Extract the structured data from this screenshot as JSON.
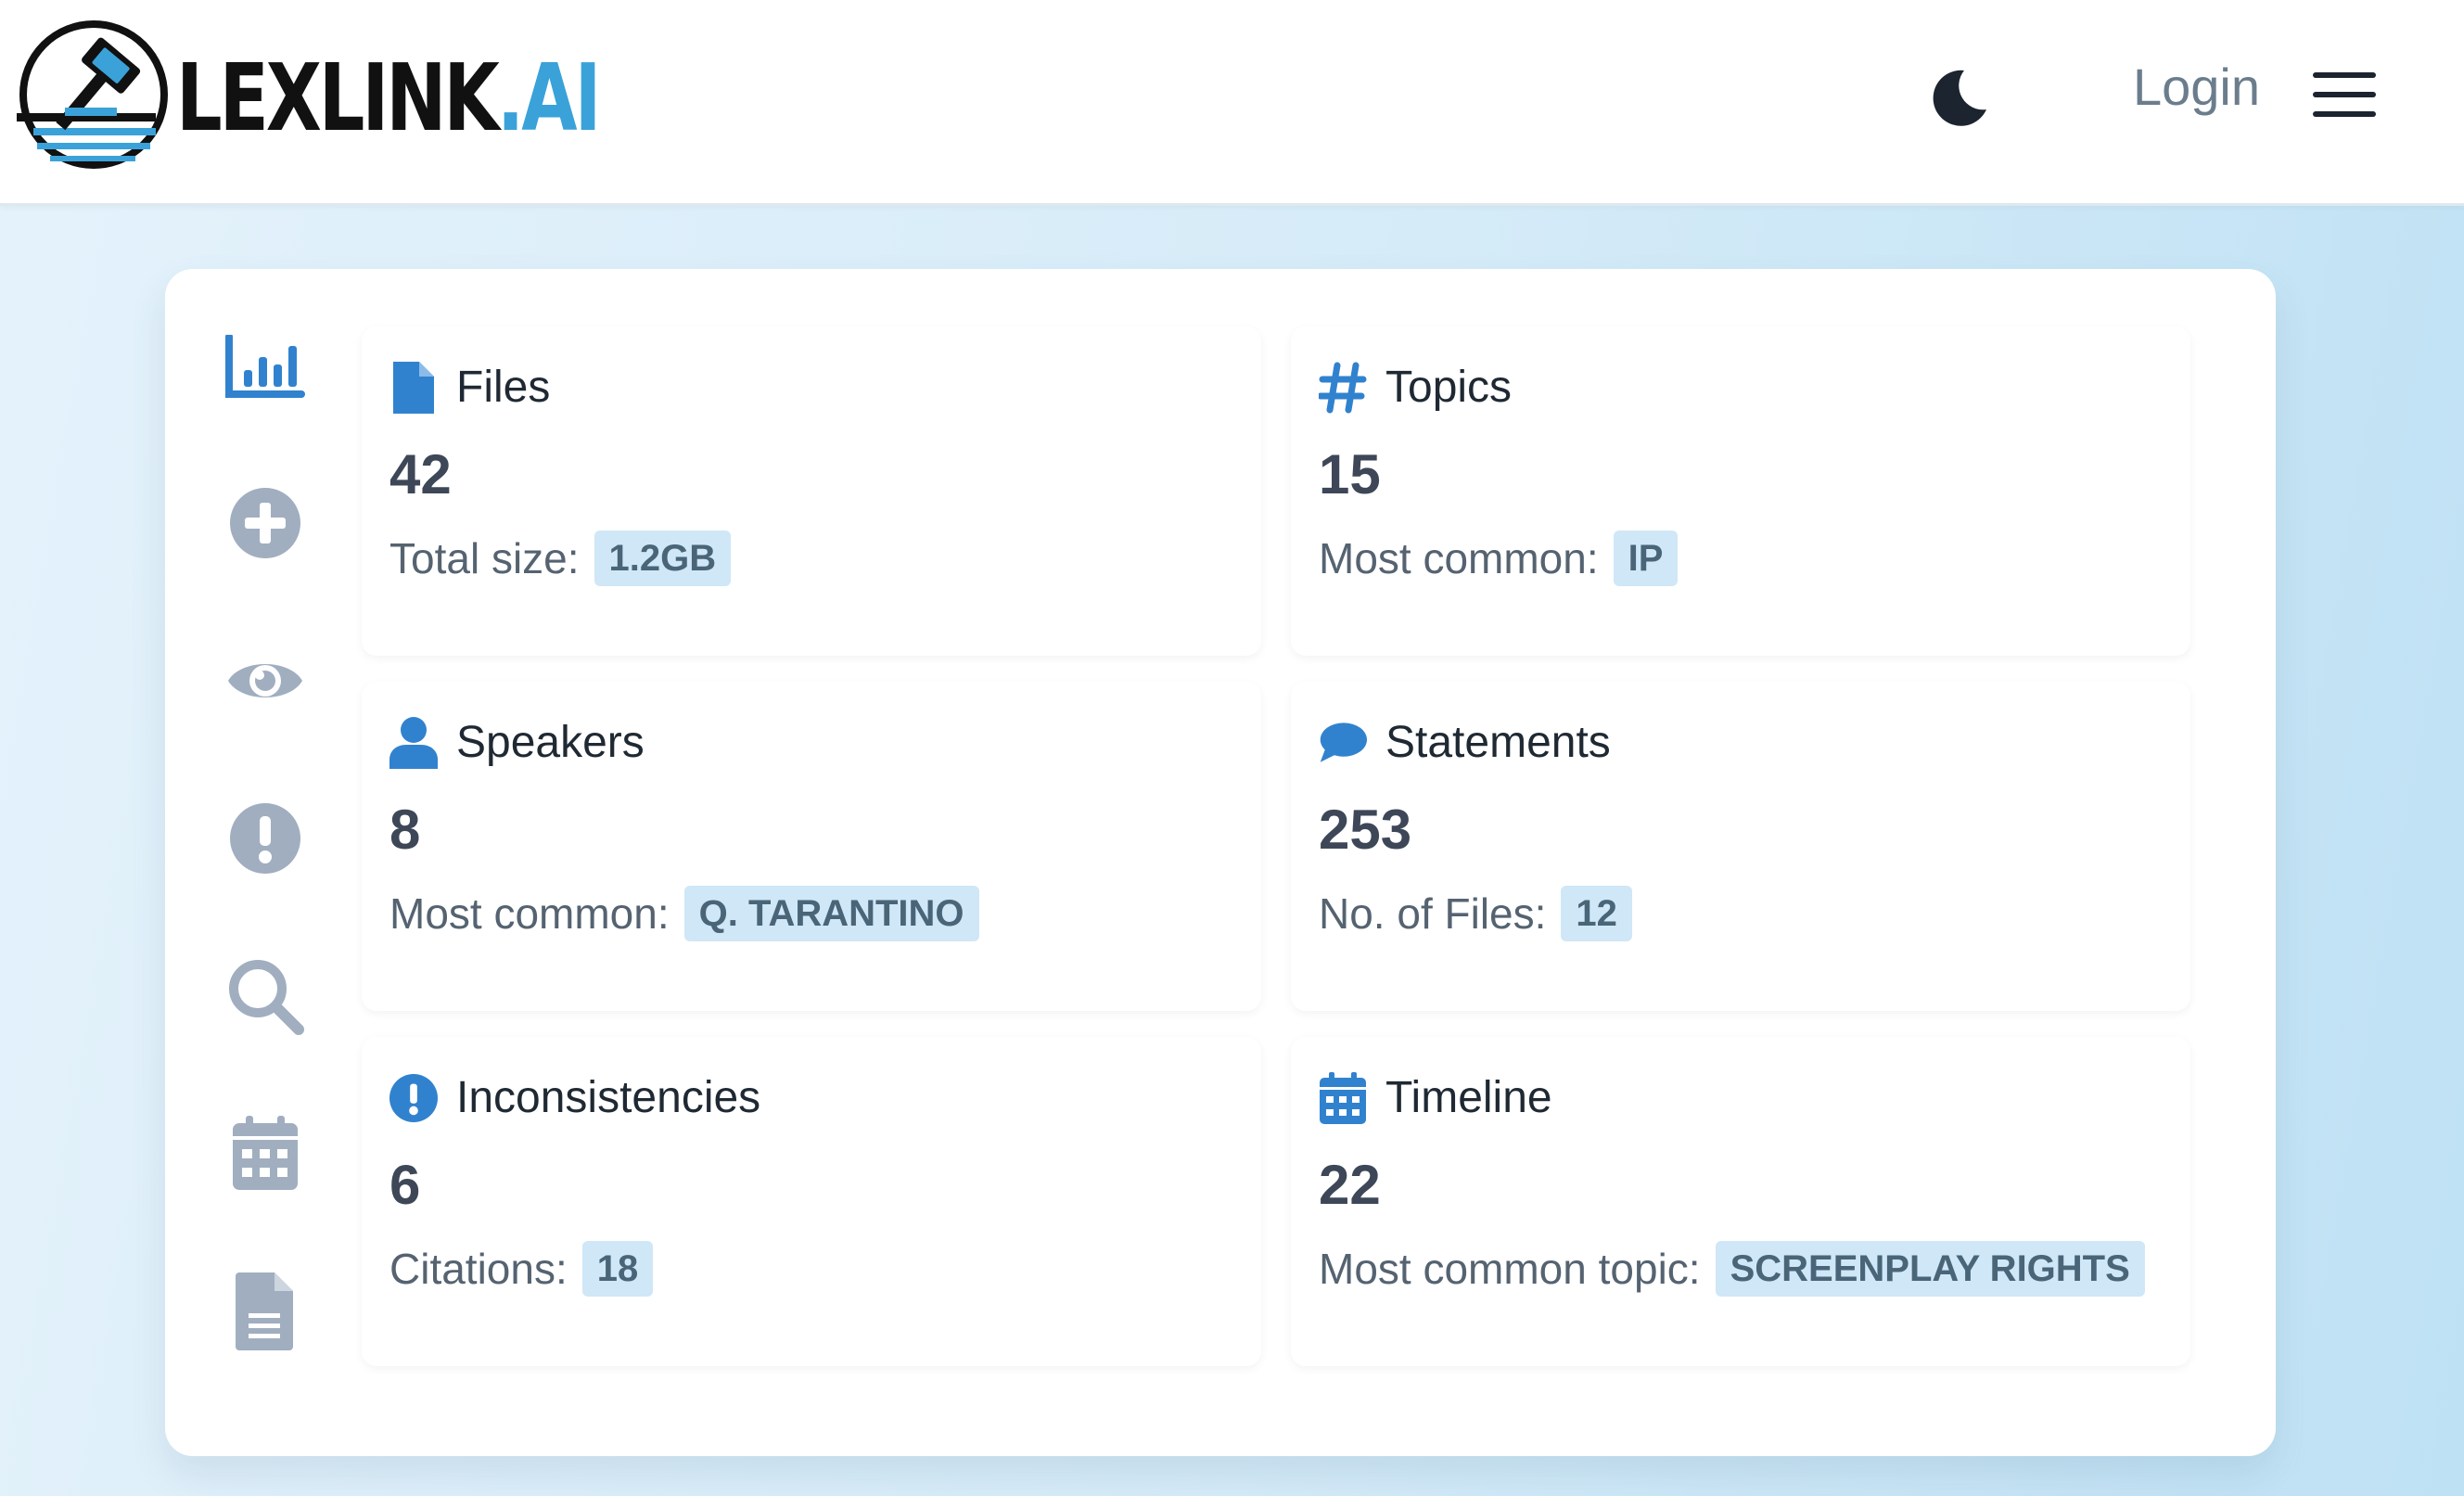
{
  "brand": {
    "name_main": "LEXLINK",
    "name_suffix": ".AI"
  },
  "header": {
    "login_label": "Login",
    "theme_icon": "moon-icon",
    "menu_icon": "hamburger-menu-icon"
  },
  "colors": {
    "accent": "#3182ce",
    "sidebar_active": "#3182ce",
    "sidebar_inactive": "#a0aec0",
    "badge_bg": "#cfe7f7",
    "badge_text": "#4a6478"
  },
  "sidebar": {
    "items": [
      {
        "icon": "bar-chart-icon",
        "active": true
      },
      {
        "icon": "plus-circle-icon",
        "active": false
      },
      {
        "icon": "eye-icon",
        "active": false
      },
      {
        "icon": "exclamation-circle-icon",
        "active": false
      },
      {
        "icon": "search-icon",
        "active": false
      },
      {
        "icon": "calendar-icon",
        "active": false
      },
      {
        "icon": "document-icon",
        "active": false
      }
    ]
  },
  "cards": {
    "files": {
      "icon": "file-icon",
      "title": "Files",
      "value": "42",
      "sub_label": "Total size:",
      "badge": "1.2GB"
    },
    "topics": {
      "icon": "hashtag-icon",
      "title": "Topics",
      "value": "15",
      "sub_label": "Most common:",
      "badge": "IP"
    },
    "speakers": {
      "icon": "user-icon",
      "title": "Speakers",
      "value": "8",
      "sub_label": "Most common:",
      "badge": "Q. TARANTINO"
    },
    "statements": {
      "icon": "speech-bubble-icon",
      "title": "Statements",
      "value": "253",
      "sub_label": "No. of Files:",
      "badge": "12"
    },
    "inconsistencies": {
      "icon": "exclamation-circle-icon",
      "title": "Inconsistencies",
      "value": "6",
      "sub_label": "Citations:",
      "badge": "18"
    },
    "timeline": {
      "icon": "calendar-icon",
      "title": "Timeline",
      "value": "22",
      "sub_label": "Most common topic:",
      "badge": "SCREENPLAY RIGHTS"
    }
  }
}
